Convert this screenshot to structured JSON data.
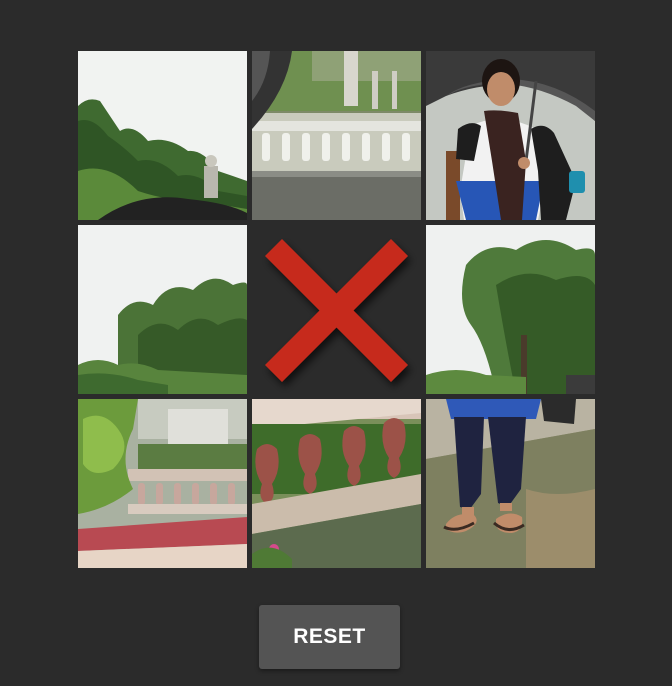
{
  "puzzle": {
    "grid_size": 3,
    "empty_tile_icon": "red-x-icon",
    "empty_tile_color": "#c62a1d",
    "background_color": "#2b2b2b",
    "tiles": [
      {
        "name": "tile-1",
        "scene": "trees-and-statue"
      },
      {
        "name": "tile-2",
        "scene": "umbrella-edge-and-white-railing"
      },
      {
        "name": "tile-3",
        "scene": "girl-with-umbrella-top"
      },
      {
        "name": "tile-4",
        "scene": "sky-and-trees"
      },
      {
        "name": "tile-5",
        "scene": "empty"
      },
      {
        "name": "tile-6",
        "scene": "tree-right"
      },
      {
        "name": "tile-7",
        "scene": "plants-and-railing"
      },
      {
        "name": "tile-8",
        "scene": "red-balustrade"
      },
      {
        "name": "tile-9",
        "scene": "girl-legs-and-sandals"
      }
    ]
  },
  "controls": {
    "reset_label": "RESET",
    "reset_color": "#545454"
  }
}
